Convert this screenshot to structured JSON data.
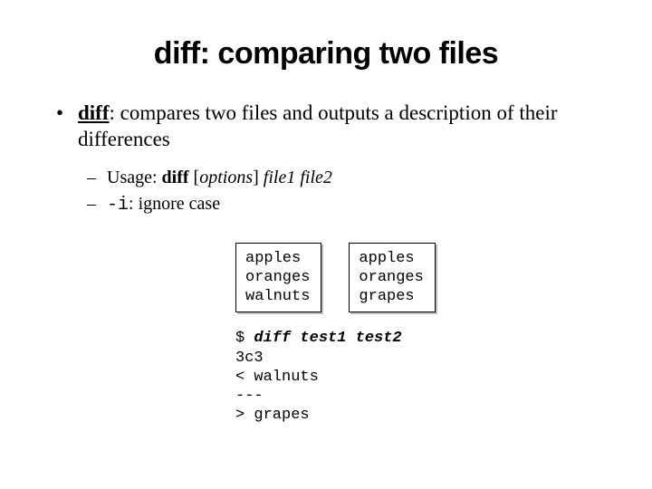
{
  "title": "diff: comparing two files",
  "bullet1": {
    "cmd": "diff",
    "rest": ": compares two files and outputs a description of their differences"
  },
  "sub1": {
    "label": "Usage: ",
    "cmd": "diff",
    "opts": " [",
    "optword": "options",
    "mid": "] ",
    "f1": "file1",
    "sp": " ",
    "f2": "file2"
  },
  "sub2": {
    "flag": "-i",
    "rest": ": ignore case"
  },
  "box1": "apples\noranges\nwalnuts",
  "box2": "apples\noranges\ngrapes",
  "term": {
    "prompt": "$ ",
    "cmd": "diff test1 test2",
    "out": "3c3\n< walnuts\n---\n> grapes"
  }
}
